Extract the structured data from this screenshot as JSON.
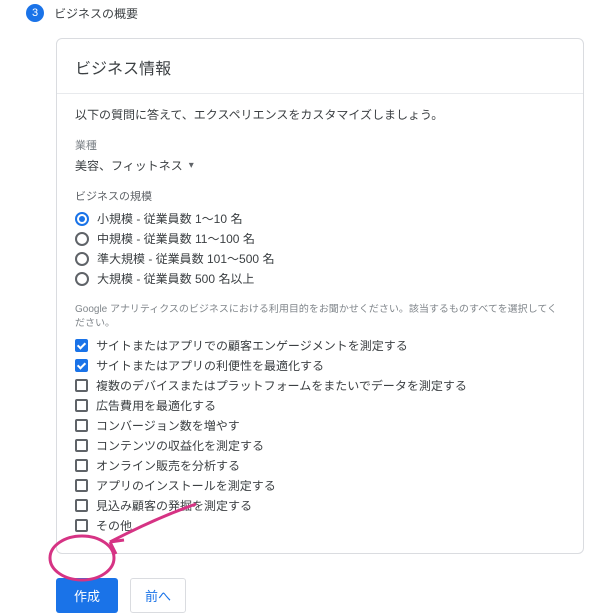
{
  "step": {
    "number": "3",
    "title": "ビジネスの概要"
  },
  "card": {
    "title": "ビジネス情報",
    "intro": "以下の質問に答えて、エクスペリエンスをカスタマイズしましょう。",
    "industry": {
      "label": "業種",
      "value": "美容、フィットネス"
    },
    "size": {
      "label": "ビジネスの規模",
      "options": [
        {
          "label": "小規模 - 従業員数 1～10 名",
          "selected": true
        },
        {
          "label": "中規模 - 従業員数 11～100 名",
          "selected": false
        },
        {
          "label": "準大規模 - 従業員数 101～500 名",
          "selected": false
        },
        {
          "label": "大規模 - 従業員数 500 名以上",
          "selected": false
        }
      ]
    },
    "purposes": {
      "label": "Google アナリティクスのビジネスにおける利用目的をお聞かせください。該当するものすべてを選択してください。",
      "options": [
        {
          "label": "サイトまたはアプリでの顧客エンゲージメントを測定する",
          "checked": true
        },
        {
          "label": "サイトまたはアプリの利便性を最適化する",
          "checked": true
        },
        {
          "label": "複数のデバイスまたはプラットフォームをまたいでデータを測定する",
          "checked": false
        },
        {
          "label": "広告費用を最適化する",
          "checked": false
        },
        {
          "label": "コンバージョン数を増やす",
          "checked": false
        },
        {
          "label": "コンテンツの収益化を測定する",
          "checked": false
        },
        {
          "label": "オンライン販売を分析する",
          "checked": false
        },
        {
          "label": "アプリのインストールを測定する",
          "checked": false
        },
        {
          "label": "見込み顧客の発掘を測定する",
          "checked": false
        },
        {
          "label": "その他",
          "checked": false
        }
      ]
    }
  },
  "buttons": {
    "create": "作成",
    "back": "前へ"
  },
  "colors": {
    "primary": "#1a73e8",
    "annotation": "#d63384"
  }
}
